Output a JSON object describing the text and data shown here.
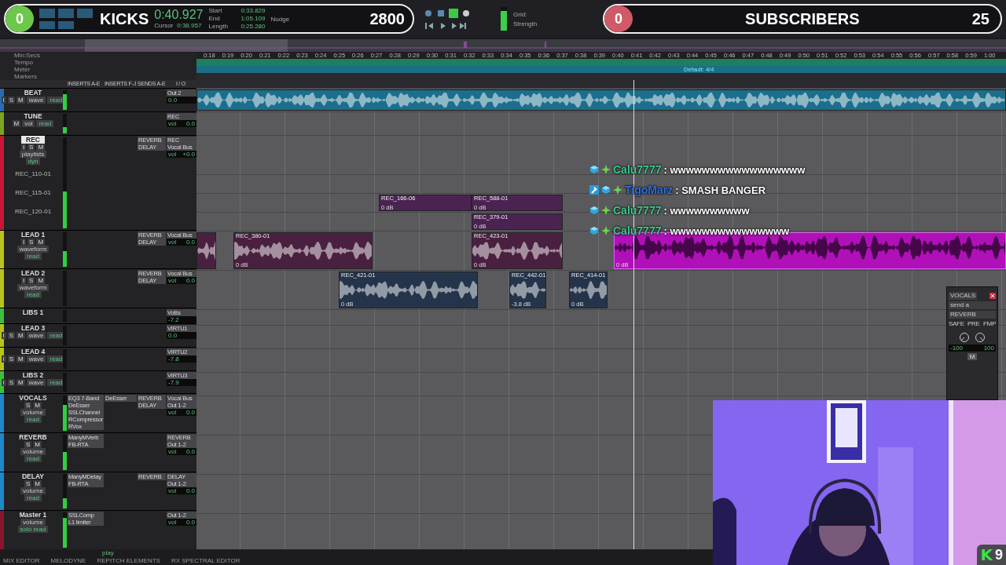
{
  "overlay_left": {
    "count": "0",
    "title": "KICKS",
    "score": "2800"
  },
  "overlay_right": {
    "count": "0",
    "title": "SUBSCRIBERS",
    "score": "25"
  },
  "transport": {
    "counter": "0:40.927",
    "cursor_label": "Cursor",
    "cursor_value": "0:38.957",
    "fields": [
      {
        "label": "Start",
        "value": "0:33.829"
      },
      {
        "label": "End",
        "value": "1:05.109"
      },
      {
        "label": "Length",
        "value": "0:25.280"
      }
    ],
    "nudge": "Nudge",
    "grid": "Grid:",
    "strength": "Strength",
    "meter": {
      "level": 0.85
    }
  },
  "rulers": [
    {
      "label": "Min:Secs",
      "kind": "ticks"
    },
    {
      "label": "Tempo",
      "kind": "tempo"
    },
    {
      "label": "Meter",
      "kind": "meter",
      "text": "Default: 4/4"
    },
    {
      "label": "Markers",
      "kind": "markers"
    }
  ],
  "ticks": [
    "0:18",
    "0:19",
    "0:20",
    "0:21",
    "0:22",
    "0:23",
    "0:24",
    "0:25",
    "0:26",
    "0:27",
    "0:28",
    "0:29",
    "0:30",
    "0:31",
    "0:32",
    "0:33",
    "0:34",
    "0:35",
    "0:36",
    "0:37",
    "0:38",
    "0:39",
    "0:40",
    "0:41",
    "0:42",
    "0:43",
    "0:44",
    "0:45",
    "0:46",
    "0:47",
    "0:48",
    "0:49",
    "0:50",
    "0:51",
    "0:52",
    "0:53",
    "0:54",
    "0:55",
    "0:56",
    "0:57",
    "0:58",
    "0:59",
    "1:00"
  ],
  "columns": [
    "INSERTS A-E",
    "INSERTS F-J",
    "SENDS A-E",
    "I / O"
  ],
  "tracks": [
    {
      "name": "BEAT",
      "color": "#2b6cb0",
      "kind": "small",
      "selected": false,
      "buttons": [
        "I",
        "S",
        "M"
      ],
      "view": "wave",
      "auto": "read",
      "level": 0.8,
      "io": [
        "Out 2"
      ],
      "fader": {
        "value": "0.0"
      },
      "clips": [
        {
          "color": "#1c6f8c",
          "selected": false
        }
      ]
    },
    {
      "name": "TUNE",
      "color": "#7aa520",
      "kind": "small",
      "selected": false,
      "buttons": [
        "M"
      ],
      "view": "vol",
      "auto": "read",
      "level": 0.3,
      "io": [
        "REC"
      ],
      "fader": {
        "label": "vol",
        "value": "0.0"
      }
    },
    {
      "name": "REC",
      "color": "#c8163a",
      "kind": "medium",
      "selected": true,
      "buttons": [
        "I",
        "S",
        "M"
      ],
      "view": "playlists",
      "auto": "dyn",
      "level": 0.4,
      "sends": [
        "REVERB",
        "DELAY"
      ],
      "io": [
        "REC",
        "Vocal Bus"
      ],
      "fader": {
        "label": "vol",
        "value": "+0.0"
      },
      "playlists": [
        {
          "name": "REC_110-01"
        },
        {
          "name": "REC_115-01",
          "clips": [
            {
              "name": "REC_166-06",
              "gain": "0 dB",
              "color": "#4b2353",
              "selected": false
            },
            {
              "name": "REC_588-01",
              "gain": "0 dB",
              "color": "#4b2353",
              "selected": false
            }
          ]
        },
        {
          "name": "REC_120-01",
          "clips": [
            {
              "name": "REC_379-01",
              "gain": "0 dB",
              "color": "#4b2353",
              "selected": false
            }
          ]
        }
      ]
    },
    {
      "name": "LEAD 1",
      "color": "#b8c41c",
      "kind": "medium",
      "selected": false,
      "buttons": [
        "I",
        "S",
        "M"
      ],
      "view": "waveform",
      "auto": "read",
      "level": 0.45,
      "sends": [
        "REVERB",
        "DELAY"
      ],
      "io": [
        "Vocal Bus"
      ],
      "fader": {
        "label": "vol",
        "value": "0.0"
      },
      "clips": [
        {
          "color": "#4a2040",
          "selected": false
        },
        {
          "name": "REC_380-01",
          "gain": "0 dB",
          "color": "#4a2040",
          "selected": false
        },
        {
          "name": "REC_423-01",
          "gain": "0 dB",
          "color": "#4a2040",
          "selected": false
        },
        {
          "gain": "0 dB",
          "color": "#b010b8",
          "selected": true
        }
      ]
    },
    {
      "name": "LEAD 2",
      "color": "#b8c41c",
      "kind": "medium",
      "selected": false,
      "buttons": [
        "I",
        "S",
        "M"
      ],
      "view": "waveform",
      "auto": "read",
      "sends": [
        "REVERB",
        "DELAY"
      ],
      "io": [
        "Vocal Bus"
      ],
      "fader": {
        "label": "vol",
        "value": "0.0"
      },
      "clips": [
        {
          "name": "REC_421-01",
          "gain": "0 dB",
          "color": "#24344a",
          "selected": false
        },
        {
          "name": "REC_442-01",
          "gain": "-3.8 dB",
          "color": "#24344a",
          "selected": false
        },
        {
          "name": "REC_414-01",
          "gain": "0 dB",
          "color": "#24344a",
          "selected": false
        }
      ]
    },
    {
      "name": "LIBS 1",
      "color": "#3fbf3f",
      "kind": "tiny",
      "selected": false,
      "io": [
        "VoBs"
      ],
      "fader": {
        "value": "-7.2"
      }
    },
    {
      "name": "LEAD 3",
      "color": "#b8c41c",
      "kind": "small",
      "selected": false,
      "buttons": [
        "I",
        "S",
        "M"
      ],
      "view": "wave",
      "auto": "read",
      "io": [
        "VIRTU1"
      ],
      "fader": {
        "value": "0.0"
      }
    },
    {
      "name": "LEAD 4",
      "color": "#b8c41c",
      "kind": "small",
      "selected": false,
      "buttons": [
        "I",
        "S",
        "M"
      ],
      "view": "wave",
      "auto": "read",
      "io": [
        "VIRTU2"
      ],
      "fader": {
        "value": "-7.8"
      }
    },
    {
      "name": "LIBS 2",
      "color": "#3fbf3f",
      "kind": "small",
      "selected": false,
      "buttons": [
        "I",
        "S",
        "M"
      ],
      "view": "wave",
      "auto": "read",
      "io": [
        "VIRTU3"
      ],
      "fader": {
        "value": "-7.9"
      }
    },
    {
      "name": "VOCALS",
      "color": "#1e88c8",
      "kind": "medium",
      "selected": false,
      "buttons": [
        "S",
        "M"
      ],
      "view": "volume",
      "auto": "read",
      "level": 0.75,
      "inserts": [
        "EQ3 7-Band",
        "DeEsser",
        "SSLChannel",
        "RCompressor",
        "RVox"
      ],
      "inserts2": [
        "DeEsser"
      ],
      "sends": [
        "REVERB",
        "DELAY"
      ],
      "io": [
        "Vocal Bus",
        "Out 1-2"
      ],
      "fader": {
        "label": "vol",
        "value": "0.0"
      }
    },
    {
      "name": "REVERB",
      "color": "#1e88c8",
      "kind": "medium",
      "selected": false,
      "buttons": [
        "S",
        "M"
      ],
      "view": "volume",
      "auto": "read",
      "level": 0.5,
      "inserts": [
        "ManyMVerb",
        "FB-RTA"
      ],
      "io": [
        "REVERB",
        "Out 1-2"
      ],
      "fader": {
        "label": "vol",
        "value": "0.0"
      }
    },
    {
      "name": "DELAY",
      "color": "#1e88c8",
      "kind": "medium",
      "selected": false,
      "buttons": [
        "S",
        "M"
      ],
      "view": "volume",
      "auto": "read",
      "level": 0.3,
      "inserts": [
        "ManyMDelay",
        "FB-RTA"
      ],
      "sends": [
        "REVERB"
      ],
      "io": [
        "DELAY",
        "Out 1-2"
      ],
      "fader": {
        "label": "vol",
        "value": "0.0"
      }
    },
    {
      "name": "Master 1",
      "color": "#8a1530",
      "kind": "medium",
      "selected": false,
      "view": "volume",
      "auto": "solo read",
      "level": 0.85,
      "inserts": [
        "SSLComp",
        "L1 limiter"
      ],
      "io": [
        "Out 1-2"
      ],
      "fader": {
        "label": "vol",
        "value": "0.0"
      }
    }
  ],
  "chat": [
    {
      "badges": [
        {
          "kind": "gem"
        },
        {
          "kind": "star"
        }
      ],
      "user": "Calu7777",
      "color": "#3ec98c",
      "message": ": wwwwwwwwwwwwwwwww"
    },
    {
      "badges": [
        {
          "kind": "sword"
        },
        {
          "kind": "gem"
        },
        {
          "kind": "star"
        }
      ],
      "user": "TigoMarz",
      "color": "#2e6fd6",
      "message": ": SMASH BANGER"
    },
    {
      "badges": [
        {
          "kind": "gem"
        },
        {
          "kind": "star"
        }
      ],
      "user": "Calu7777",
      "color": "#3ec98c",
      "message": ": wwwwwwwwww"
    },
    {
      "badges": [
        {
          "kind": "gem"
        },
        {
          "kind": "star"
        }
      ],
      "user": "Calu7777",
      "color": "#3ec98c",
      "message": ": wwwwwwwwwwwwwww"
    }
  ],
  "send_window": {
    "track": "VOCALS",
    "send": "send a",
    "bus": "REVERB",
    "flags": [
      "SAFE",
      "PRE",
      "FMP"
    ],
    "pans": [
      "-100",
      "100"
    ],
    "mute": "M"
  },
  "status_bar": {
    "text": "play",
    "tabs": [
      "MIX EDITOR",
      "MELODYNE",
      "REPITCH ELEMENTS",
      "RX SPECTRAL EDITOR"
    ]
  },
  "webcam": {
    "kind": "picture"
  },
  "kick_badge": {
    "logo": "K",
    "count": "9"
  }
}
